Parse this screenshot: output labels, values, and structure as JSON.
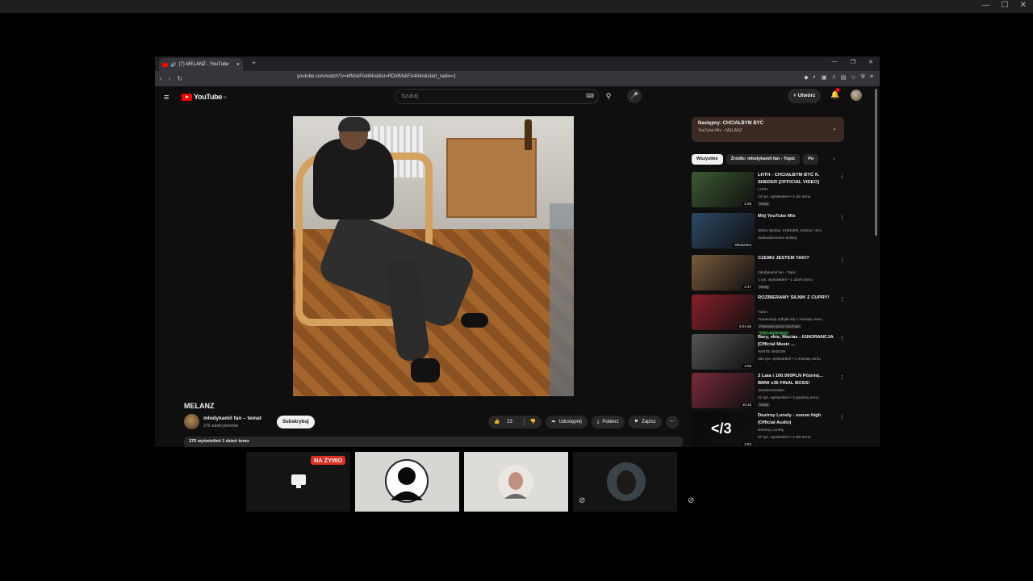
{
  "outer": {
    "controls": [
      "—",
      "☐",
      "✕"
    ]
  },
  "browser": {
    "tab_title": "(7) MELANZ - YouTube",
    "tab_close": "×",
    "new_tab": "+",
    "window_controls": [
      "—",
      "❐",
      "✕"
    ],
    "url": "youtube.com/watch?v=kfMskFA484o&list=RDkfMskFA484o&start_radio=1"
  },
  "youtube": {
    "logo_text": "YouTube",
    "region": "PL",
    "search_placeholder": "Szukaj",
    "create_label": "Utwórz",
    "notif_count": "7"
  },
  "video": {
    "title": "MELANZ",
    "channel": "młodykamil fan – temat",
    "subscribers": "276 subskrybentów",
    "subscribe_label": "Subskrybuj",
    "likes": "23",
    "share_label": "Udostępnij",
    "download_label": "Pobierz",
    "save_label": "Zapisz",
    "description_meta": "375 wyświetleń  1 dzień temu"
  },
  "up_next": {
    "title": "Następny: CHCIAŁBYM BYĆ",
    "subtitle": "YouTube Mix – MELANZ"
  },
  "chips": [
    "Wszystkie",
    "Źródło: młodykamil fan - Topic",
    "Po"
  ],
  "recommendations": [
    {
      "title": "LHTH - CHCIAŁBYM BYĆ ft. SHEDER [OFFICIAL VIDEO]",
      "channel": "LHTH",
      "meta": "23 tys. wyświetleń • 2 dni temu",
      "badge": "Nowy",
      "duration": "2:39",
      "thumb_color": "#3c5a32"
    },
    {
      "title": "Mój YouTube Mix",
      "channel": "White Widow, SHEDER, Kidzior i inni",
      "meta": "Zaktualizowano dzisiaj",
      "badge": "",
      "duration": "Składanka",
      "thumb_color": "#2c4a66"
    },
    {
      "title": "CZEMU JESTEM TAKI?",
      "channel": "młodykamil fan - Topic",
      "meta": "1 tys. wyświetleń • 1 dzień temu",
      "badge": "Nowy",
      "duration": "2:47",
      "thumb_color": "#7a5a3a"
    },
    {
      "title": "ROZBIERAMY SILNIK Z CUPRY!",
      "channel": "Yokm",
      "meta": "Transmisja odbyła się 1 miesiąc temu",
      "badge": "Polecane przez YouTube",
      "member": "Tylko wspierający",
      "duration": "5:01:55",
      "thumb_color": "#8a1f2a"
    },
    {
      "title": "Bary, vkie, Macias - IGNORANCJA [Official Music ...",
      "channel": "WHITE WIDOW",
      "meta": "391 tys. wyświetleń • 1 miesiąc temu",
      "badge": "",
      "duration": "4:06",
      "thumb_color": "#555555"
    },
    {
      "title": "3 Lata i 100.000PLN Później... BMW e36 FINAL BOSS!",
      "channel": "StrzeleckiVideo",
      "meta": "21 tys. wyświetleń • 3 godziny temu",
      "badge": "Nowy",
      "duration": "29:18",
      "thumb_color": "#7a2a3a"
    },
    {
      "title": "Destroy Lonely - soooo high (Official Audio)",
      "channel": "Destroy Lonely",
      "meta": "57 tys. wyświetleń • 2 dni temu",
      "badge": "",
      "duration": "3:52",
      "thumb_color": "#0a0a0a",
      "thumb_text": "</3"
    }
  ],
  "call": {
    "live_label": "NA ŻYWO"
  }
}
